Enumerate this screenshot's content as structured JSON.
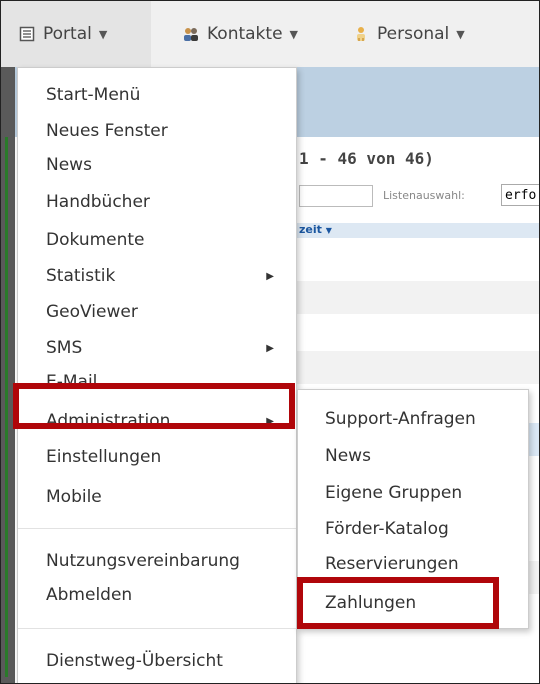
{
  "nav": {
    "portal": {
      "label": "Portal",
      "icon": "portal-icon"
    },
    "kontakte": {
      "label": "Kontakte",
      "icon": "contacts-icon"
    },
    "personal": {
      "label": "Personal",
      "icon": "person-icon"
    }
  },
  "background": {
    "count": "1 - 46 von 46)",
    "list_label": "Listenauswahl:",
    "list_value": "erfo",
    "column_header": "zeit"
  },
  "menu": {
    "items": [
      {
        "label": "Start-Menü"
      },
      {
        "label": "Neues Fenster"
      },
      {
        "label": "News"
      },
      {
        "label": "Handbücher"
      },
      {
        "label": "Dokumente"
      },
      {
        "label": "Statistik",
        "submenu": true
      },
      {
        "label": "GeoViewer"
      },
      {
        "label": "SMS",
        "submenu": true
      },
      {
        "label": "E-Mail"
      },
      {
        "label": "Administration",
        "submenu": true
      },
      {
        "label": "Einstellungen"
      },
      {
        "label": "Mobile"
      },
      {
        "label": "Nutzungsvereinbarung"
      },
      {
        "label": "Abmelden"
      },
      {
        "label": "Dienstweg-Übersicht"
      }
    ]
  },
  "submenu": {
    "items": [
      {
        "label": "Support-Anfragen"
      },
      {
        "label": "News"
      },
      {
        "label": "Eigene Gruppen"
      },
      {
        "label": "Förder-Katalog"
      },
      {
        "label": "Reservierungen"
      },
      {
        "label": "Zahlungen"
      }
    ]
  },
  "colors": {
    "highlight": "#b0060a",
    "header_blue": "#bcd0e2"
  }
}
